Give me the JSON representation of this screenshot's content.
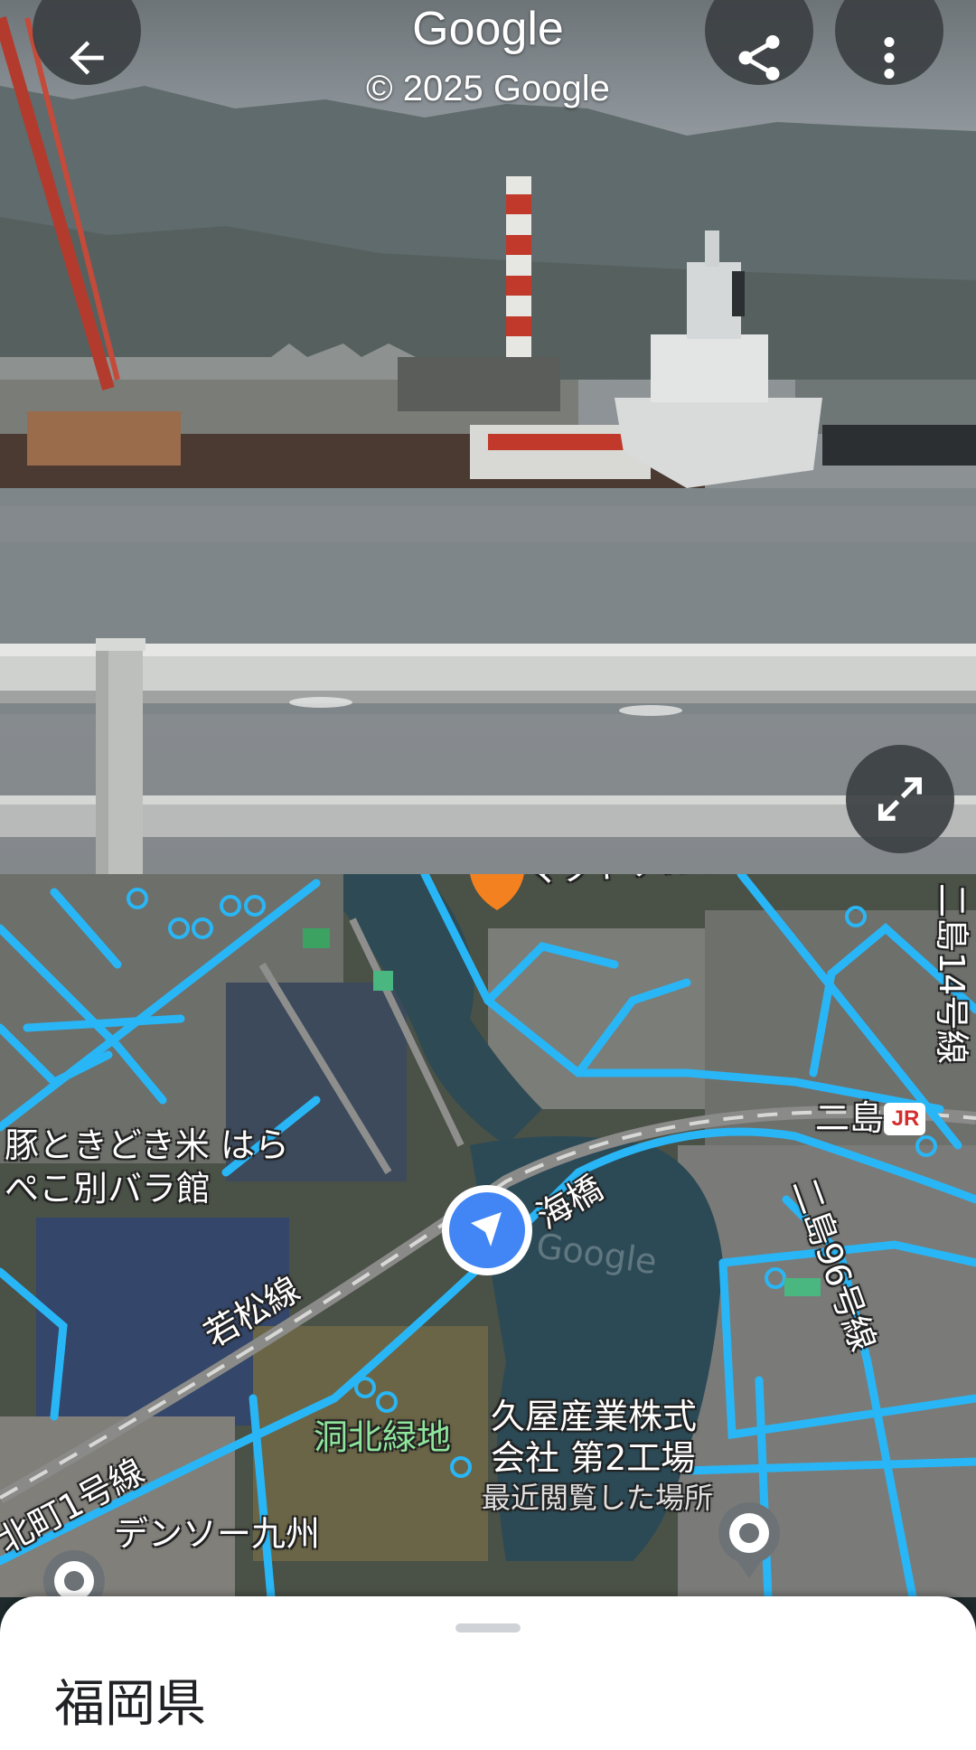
{
  "street_view": {
    "title": "Google",
    "copyright": "© 2025 Google",
    "icons": {
      "back": "arrow-left-icon",
      "share": "share-icon",
      "more": "more-vert-icon",
      "expand": "expand-icon"
    }
  },
  "map": {
    "labels": {
      "restaurant_line1": "豚ときどき米 はら",
      "restaurant_line2": "ぺこ別バラ館",
      "bridge": "海橋",
      "wakamatsu_line": "若松線",
      "station": "二島",
      "station_badge": "JR",
      "route14": "二島14号線",
      "route96": "二島96号線",
      "kitamachi": "北町1号線",
      "park": "洞北緑地",
      "factory_line1": "久屋産業株式",
      "factory_line2": "会社 第2工場",
      "factory_line3": "最近閲覧した場所",
      "denso": "デンソー九州",
      "top_partial": "マクドナルド",
      "watermark": "Google"
    },
    "colors": {
      "route": "#29b6f6",
      "accent": "#4285f4",
      "water": "#2c4a56",
      "orange_pin": "#f4811f"
    }
  },
  "sheet": {
    "title": "福岡県"
  }
}
